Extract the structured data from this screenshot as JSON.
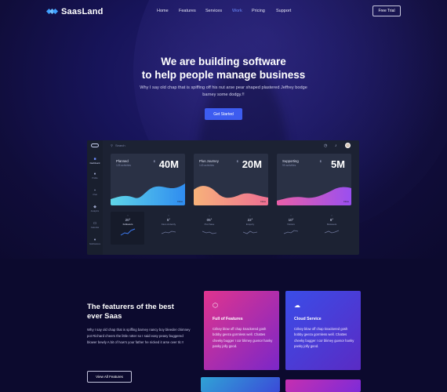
{
  "brand": {
    "name": "SaasLand"
  },
  "nav": {
    "items": [
      {
        "label": "Home",
        "active": false
      },
      {
        "label": "Features",
        "active": false
      },
      {
        "label": "Services",
        "active": false
      },
      {
        "label": "Work",
        "active": true
      },
      {
        "label": "Pricing",
        "active": false
      },
      {
        "label": "Support",
        "active": false
      }
    ],
    "cta_label": "Free Trial"
  },
  "hero": {
    "title_line1": "We are building software",
    "title_line2": "to help people manage business",
    "subtitle": "Why I say old chap that is spiffing off his nut arse pear shaped plastered Jeffrey bodge barney some dodgy.!!",
    "button_label": "Get Started"
  },
  "dashboard": {
    "search_placeholder": "Search",
    "sidebar": [
      {
        "label": "Dashboard",
        "icon": "grid-icon",
        "active": true
      },
      {
        "label": "Profile",
        "icon": "user-icon",
        "active": false
      },
      {
        "label": "Chat",
        "icon": "chat-icon",
        "active": false
      },
      {
        "label": "Analytics",
        "icon": "chart-icon",
        "active": false
      },
      {
        "label": "Calendar",
        "icon": "calendar-icon",
        "active": false
      },
      {
        "label": "Notifications",
        "icon": "bell-icon",
        "active": false
      }
    ],
    "cards": [
      {
        "title": "Planned",
        "subtitle": "125 activities",
        "value": "40M",
        "end": "Close",
        "gradient": [
          "#5fd6e8",
          "#2f8cf0"
        ]
      },
      {
        "title": "Plus Journey",
        "subtitle": "143 activities",
        "value": "20M",
        "end": "Close",
        "gradient": [
          "#f7b27a",
          "#ee6f92"
        ]
      },
      {
        "title": "Supporting",
        "subtitle": "99 activities",
        "value": "5M",
        "end": "Close",
        "gradient": [
          "#e95fa8",
          "#9a4ff0"
        ]
      }
    ],
    "stats": [
      {
        "arrow": "↑",
        "value": "20°",
        "label": "Followers"
      },
      {
        "arrow": "↑",
        "value": "5°",
        "label": "Fans Ardently"
      },
      {
        "arrow": "↓",
        "value": "05°",
        "label": "Purchase"
      },
      {
        "arrow": "↓",
        "value": "22°",
        "label": "Enquiry"
      },
      {
        "arrow": "↑",
        "value": "10°",
        "label": "Visitors"
      },
      {
        "arrow": "↑",
        "value": "8°",
        "label": "Retweets"
      }
    ]
  },
  "features": {
    "title_line1": "The featurers of the best",
    "title_line2": "ever Saas",
    "body": "Why I say old chap that is spiffing barney nancy boy bleeder chimney pot Richard cheers the little rotter so I said easy peasy buggered blower bewly A bit of how's your father he nicked it arse over tit.!!",
    "button_label": "View All Features",
    "cards": [
      {
        "title": "Full of Features",
        "icon": "box-icon",
        "desc": "Crikey blow off chap knackered gosh bobby geeza gormless well. Chattes cheeky bugger I cor blimey guvnor hanky panky jolly good.",
        "gradient": [
          "#e0348e",
          "#7b27c8"
        ]
      },
      {
        "title": "Cloud Service",
        "icon": "cloud-icon",
        "desc": "Crikey blow off chap knackered gosh bobby geeza gormless well. Chattes cheeky bugger I cor blimey guvnor hanky panky jolly good.",
        "gradient": [
          "#3a4de8",
          "#5a2bc4"
        ]
      },
      {
        "title": "",
        "icon": "",
        "desc": "",
        "gradient": [
          "#2fa3d6",
          "#3b4ad8"
        ]
      },
      {
        "title": "",
        "icon": "",
        "desc": "",
        "gradient": [
          "#c62fb0",
          "#7d2bd8"
        ]
      }
    ]
  }
}
